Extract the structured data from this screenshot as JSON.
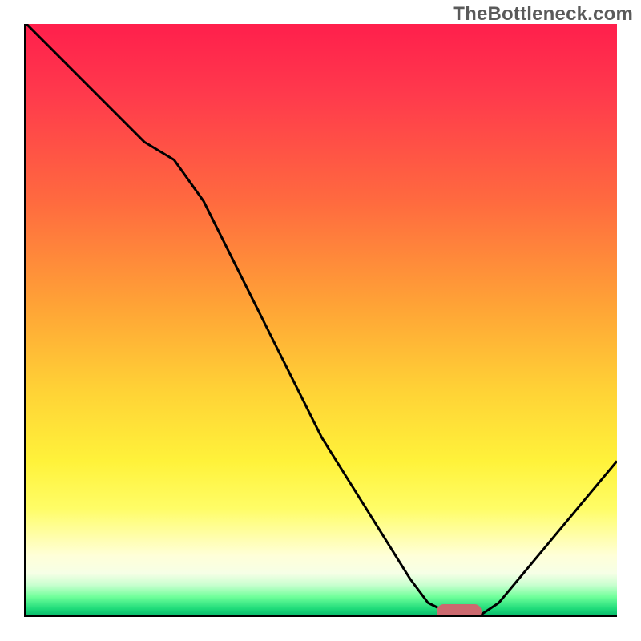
{
  "attribution": "TheBottleneck.com",
  "chart_data": {
    "type": "line",
    "title": "",
    "xlabel": "",
    "ylabel": "",
    "x": [
      0.0,
      0.05,
      0.1,
      0.15,
      0.2,
      0.25,
      0.3,
      0.35,
      0.4,
      0.45,
      0.5,
      0.55,
      0.6,
      0.65,
      0.68,
      0.72,
      0.77,
      0.8,
      0.85,
      0.9,
      0.95,
      1.0
    ],
    "values": [
      1.0,
      0.95,
      0.9,
      0.85,
      0.8,
      0.77,
      0.7,
      0.6,
      0.5,
      0.4,
      0.3,
      0.22,
      0.14,
      0.06,
      0.02,
      0.0,
      0.0,
      0.02,
      0.08,
      0.14,
      0.2,
      0.26
    ],
    "xlim": [
      0,
      1
    ],
    "ylim": [
      0,
      1
    ],
    "marker": {
      "x": 0.73,
      "y": 0.01
    },
    "background_gradient": {
      "orientation": "vertical",
      "stops": [
        {
          "pos": 0.0,
          "color": "#ff1f4c"
        },
        {
          "pos": 0.3,
          "color": "#ff6a3f"
        },
        {
          "pos": 0.62,
          "color": "#ffd236"
        },
        {
          "pos": 0.82,
          "color": "#fffd66"
        },
        {
          "pos": 0.93,
          "color": "#f6ffe6"
        },
        {
          "pos": 1.0,
          "color": "#0bbf6e"
        }
      ]
    }
  }
}
